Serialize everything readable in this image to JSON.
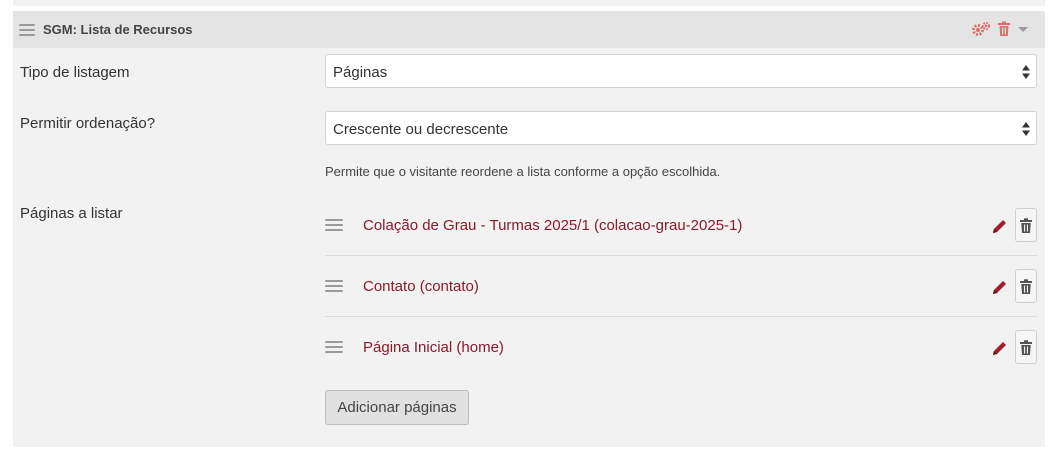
{
  "panel": {
    "title": "SGM: Lista de Recursos"
  },
  "fields": {
    "tipo_label": "Tipo de listagem",
    "tipo_value": "Páginas",
    "ordenacao_label": "Permitir ordenação?",
    "ordenacao_value": "Crescente ou decrescente",
    "ordenacao_help": "Permite que o visitante reordene a lista conforme a opção escolhida.",
    "paginas_label": "Páginas a listar"
  },
  "pages": [
    {
      "label": "Colação de Grau - Turmas 2025/1 (colacao-grau-2025-1)"
    },
    {
      "label": "Contato (contato)"
    },
    {
      "label": "Página Inicial (home)"
    }
  ],
  "add_button": "Adicionar páginas",
  "colors": {
    "accent": "#8b1a2b",
    "header_icons": "#d9706a",
    "panel_bg": "#f2f2f2",
    "header_bg": "#e4e4e4"
  }
}
